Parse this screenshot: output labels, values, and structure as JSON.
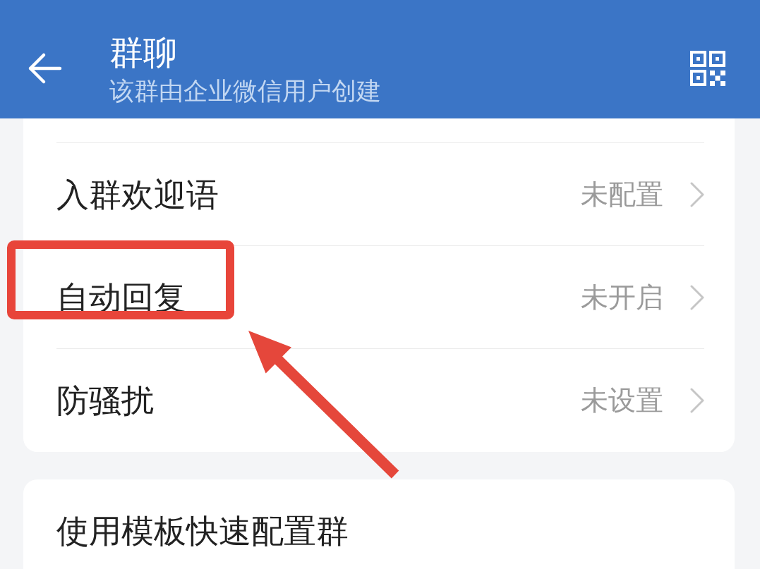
{
  "header": {
    "title": "群聊",
    "subtitle": "该群由企业微信用户创建"
  },
  "settings": [
    {
      "label": "入群欢迎语",
      "value": "未配置",
      "highlighted": false
    },
    {
      "label": "自动回复",
      "value": "未开启",
      "highlighted": true
    },
    {
      "label": "防骚扰",
      "value": "未设置",
      "highlighted": false
    }
  ],
  "actions": [
    {
      "label": "使用模板快速配置群"
    }
  ]
}
